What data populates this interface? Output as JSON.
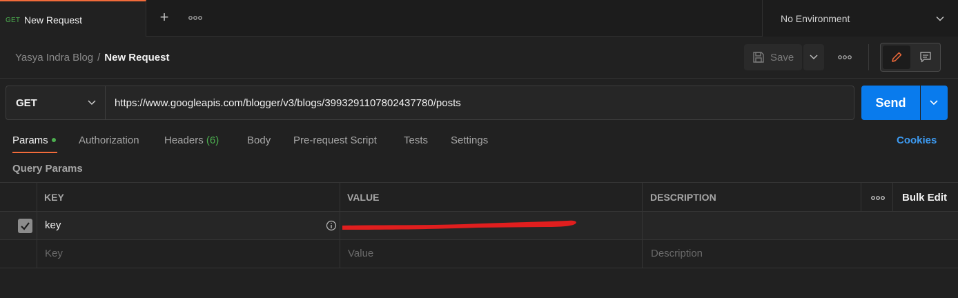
{
  "tab": {
    "method": "GET",
    "title": "New Request"
  },
  "environment": {
    "label": "No Environment"
  },
  "breadcrumb": {
    "workspace": "Yasya Indra Blog",
    "separator": "/",
    "current": "New Request"
  },
  "toolbar": {
    "save_label": "Save"
  },
  "request": {
    "method": "GET",
    "url": "https://www.googleapis.com/blogger/v3/blogs/3993291107802437780/posts",
    "send_label": "Send"
  },
  "request_tabs": [
    {
      "label": "Params"
    },
    {
      "label": "Authorization"
    },
    {
      "label": "Headers",
      "count": "(6)"
    },
    {
      "label": "Body"
    },
    {
      "label": "Pre-request Script"
    },
    {
      "label": "Tests"
    },
    {
      "label": "Settings"
    }
  ],
  "cookies_label": "Cookies",
  "query_params": {
    "title": "Query Params",
    "headers": {
      "key": "KEY",
      "value": "VALUE",
      "description": "DESCRIPTION"
    },
    "bulk_edit_label": "Bulk Edit",
    "rows": [
      {
        "key": "key",
        "value": "",
        "description": "",
        "checked": true
      }
    ],
    "placeholders": {
      "key": "Key",
      "value": "Value",
      "description": "Description"
    }
  },
  "colors": {
    "accent": "#f26b3a",
    "send": "#097bed",
    "link": "#3d9bf2",
    "method_get": "#4cae4f",
    "redaction": "#e01e1e"
  },
  "icons": [
    "plus-icon",
    "more-icon",
    "chevron-down-icon",
    "save-icon",
    "pencil-icon",
    "comment-icon",
    "check-icon",
    "info-icon"
  ]
}
